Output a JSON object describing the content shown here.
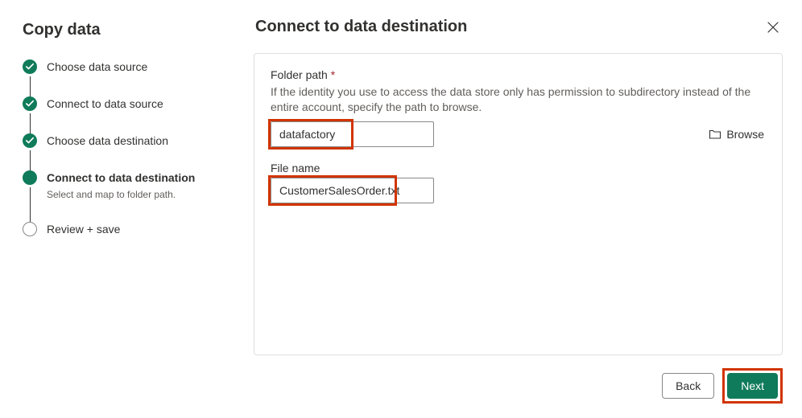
{
  "sidebar": {
    "title": "Copy data",
    "steps": [
      {
        "label": "Choose data source",
        "state": "done"
      },
      {
        "label": "Connect to data source",
        "state": "done"
      },
      {
        "label": "Choose data destination",
        "state": "done"
      },
      {
        "label": "Connect to data destination",
        "sublabel": "Select and map to folder path.",
        "state": "active"
      },
      {
        "label": "Review + save",
        "state": "pending"
      }
    ]
  },
  "main": {
    "title": "Connect to data destination",
    "folder_path": {
      "label": "Folder path",
      "required_mark": "*",
      "help": "If the identity you use to access the data store only has permission to subdirectory instead of the entire account, specify the path to browse.",
      "value": "datafactory",
      "browse_label": "Browse"
    },
    "file_name": {
      "label": "File name",
      "value": "CustomerSalesOrder.txt"
    }
  },
  "footer": {
    "back_label": "Back",
    "next_label": "Next"
  }
}
